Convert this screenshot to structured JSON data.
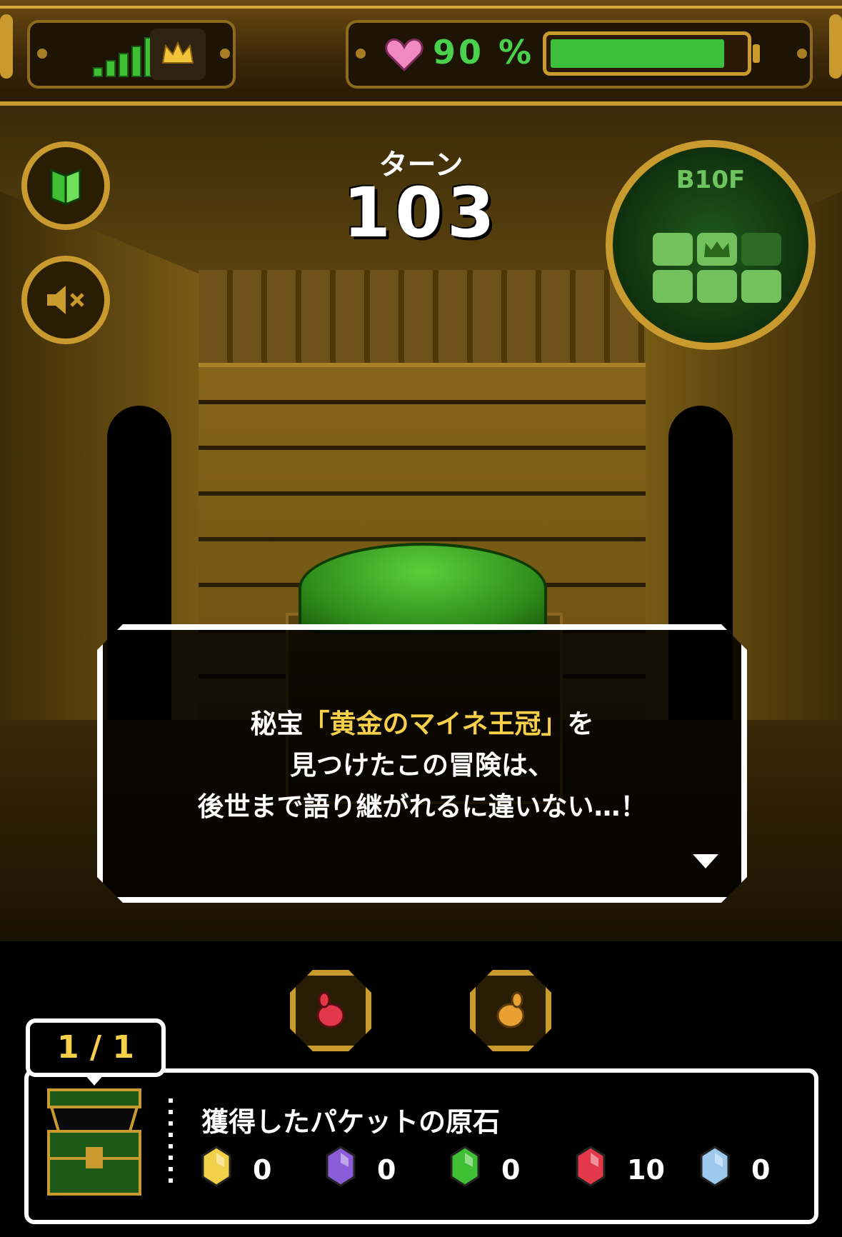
{
  "status_bar": {
    "hp_percent_text": "90 %",
    "hp_fraction": 0.9
  },
  "turn": {
    "label": "ターン",
    "value": "103"
  },
  "minimap": {
    "floor": "B10F"
  },
  "dialog": {
    "line1_prefix": "秘宝",
    "line1_highlight": "「黄金のマイネ王冠」",
    "line1_suffix": "を",
    "line2": "見つけたこの冒険は、",
    "line3": "後世まで語り継がれるに違いない…！"
  },
  "item_buttons": [
    {
      "icon": "red-seed-icon"
    },
    {
      "icon": "orange-seed-icon"
    }
  ],
  "treasure": {
    "counter": "1 / 1",
    "title": "獲得したパケットの原石"
  },
  "gems": [
    {
      "icon": "yellow-gem-icon",
      "count": "0",
      "color": "#f2d14a"
    },
    {
      "icon": "rainbow-gem-icon",
      "count": "0",
      "color": "#8a5cd8"
    },
    {
      "icon": "green-gem-icon",
      "count": "0",
      "color": "#3fbf34"
    },
    {
      "icon": "red-gem-icon",
      "count": "10",
      "color": "#e2384a"
    },
    {
      "icon": "blue-gem-icon",
      "count": "0",
      "color": "#9cc8ee"
    }
  ],
  "colors": {
    "gold": "#c99a2e",
    "highlight": "#f6d04b",
    "hp_green": "#3cbf3a"
  }
}
